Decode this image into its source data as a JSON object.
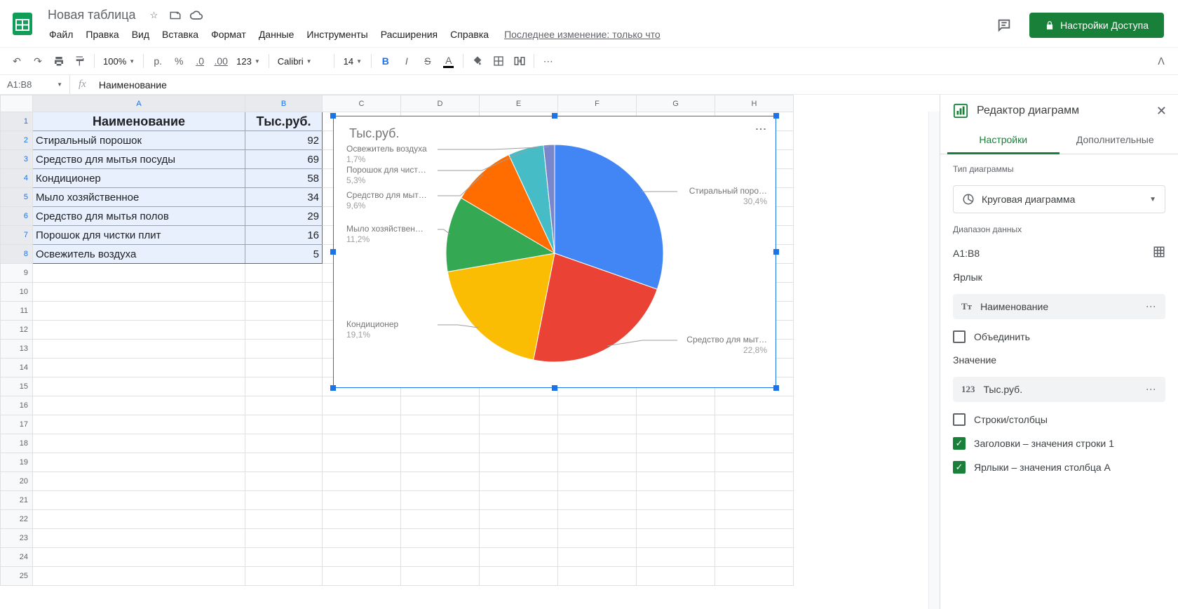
{
  "doc_title": "Новая таблица",
  "menu": [
    "Файл",
    "Правка",
    "Вид",
    "Вставка",
    "Формат",
    "Данные",
    "Инструменты",
    "Расширения",
    "Справка"
  ],
  "last_modified": "Последнее изменение: только что",
  "share_label": "Настройки Доступа",
  "toolbar": {
    "zoom": "100%",
    "currency_symbol": "р.",
    "percent": "%",
    "dec_dec": ".0",
    "inc_dec": ".00",
    "more_formats": "123",
    "font": "Calibri",
    "font_size": "14"
  },
  "name_box": "A1:B8",
  "formula_value": "Наименование",
  "columns": [
    "A",
    "B",
    "C",
    "D",
    "E",
    "F",
    "G",
    "H"
  ],
  "row_count": 25,
  "data": {
    "headers": [
      "Наименование",
      "Тыс.руб."
    ],
    "rows": [
      [
        "Стиральный порошок",
        "92"
      ],
      [
        "Средство для мытья посуды",
        "69"
      ],
      [
        "Кондиционер",
        "58"
      ],
      [
        "Мыло хозяйственное",
        "34"
      ],
      [
        "Средство для мытья полов",
        "29"
      ],
      [
        "Порошок для чистки плит",
        "16"
      ],
      [
        "Освежитель воздуха",
        "5"
      ]
    ]
  },
  "chart_data": {
    "type": "pie",
    "title": "Тыс.руб.",
    "labels": [
      {
        "name": "Стиральный поро…",
        "pct": "30,4%",
        "value": 92,
        "color": "#4285f4"
      },
      {
        "name": "Средство для мыт…",
        "pct": "22,8%",
        "value": 69,
        "color": "#ea4335"
      },
      {
        "name": "Кондиционер",
        "pct": "19,1%",
        "value": 58,
        "color": "#fbbc04"
      },
      {
        "name": "Мыло хозяйствен…",
        "pct": "11,2%",
        "value": 34,
        "color": "#34a853"
      },
      {
        "name": "Средство для мыт…",
        "pct": "9,6%",
        "value": 29,
        "color": "#ff6d01"
      },
      {
        "name": "Порошок для чист…",
        "pct": "5,3%",
        "value": 16,
        "color": "#46bdc6"
      },
      {
        "name": "Освежитель воздуха",
        "pct": "1,7%",
        "value": 5,
        "color": "#7986cb"
      }
    ]
  },
  "editor": {
    "title": "Редактор диаграмм",
    "tabs": [
      "Настройки",
      "Дополнительные"
    ],
    "type_label": "Тип диаграммы",
    "type_value": "Круговая диаграмма",
    "range_label": "Диапазон данных",
    "range_value": "A1:B8",
    "label_section": "Ярлык",
    "label_chip": "Наименование",
    "combine_label": "Объединить",
    "value_section": "Значение",
    "value_chip": "Тыс.руб.",
    "rows_cols_label": "Строки/столбцы",
    "headers_row1_label": "Заголовки – значения строки 1",
    "labels_colA_label": "Ярлыки – значения столбца A"
  }
}
